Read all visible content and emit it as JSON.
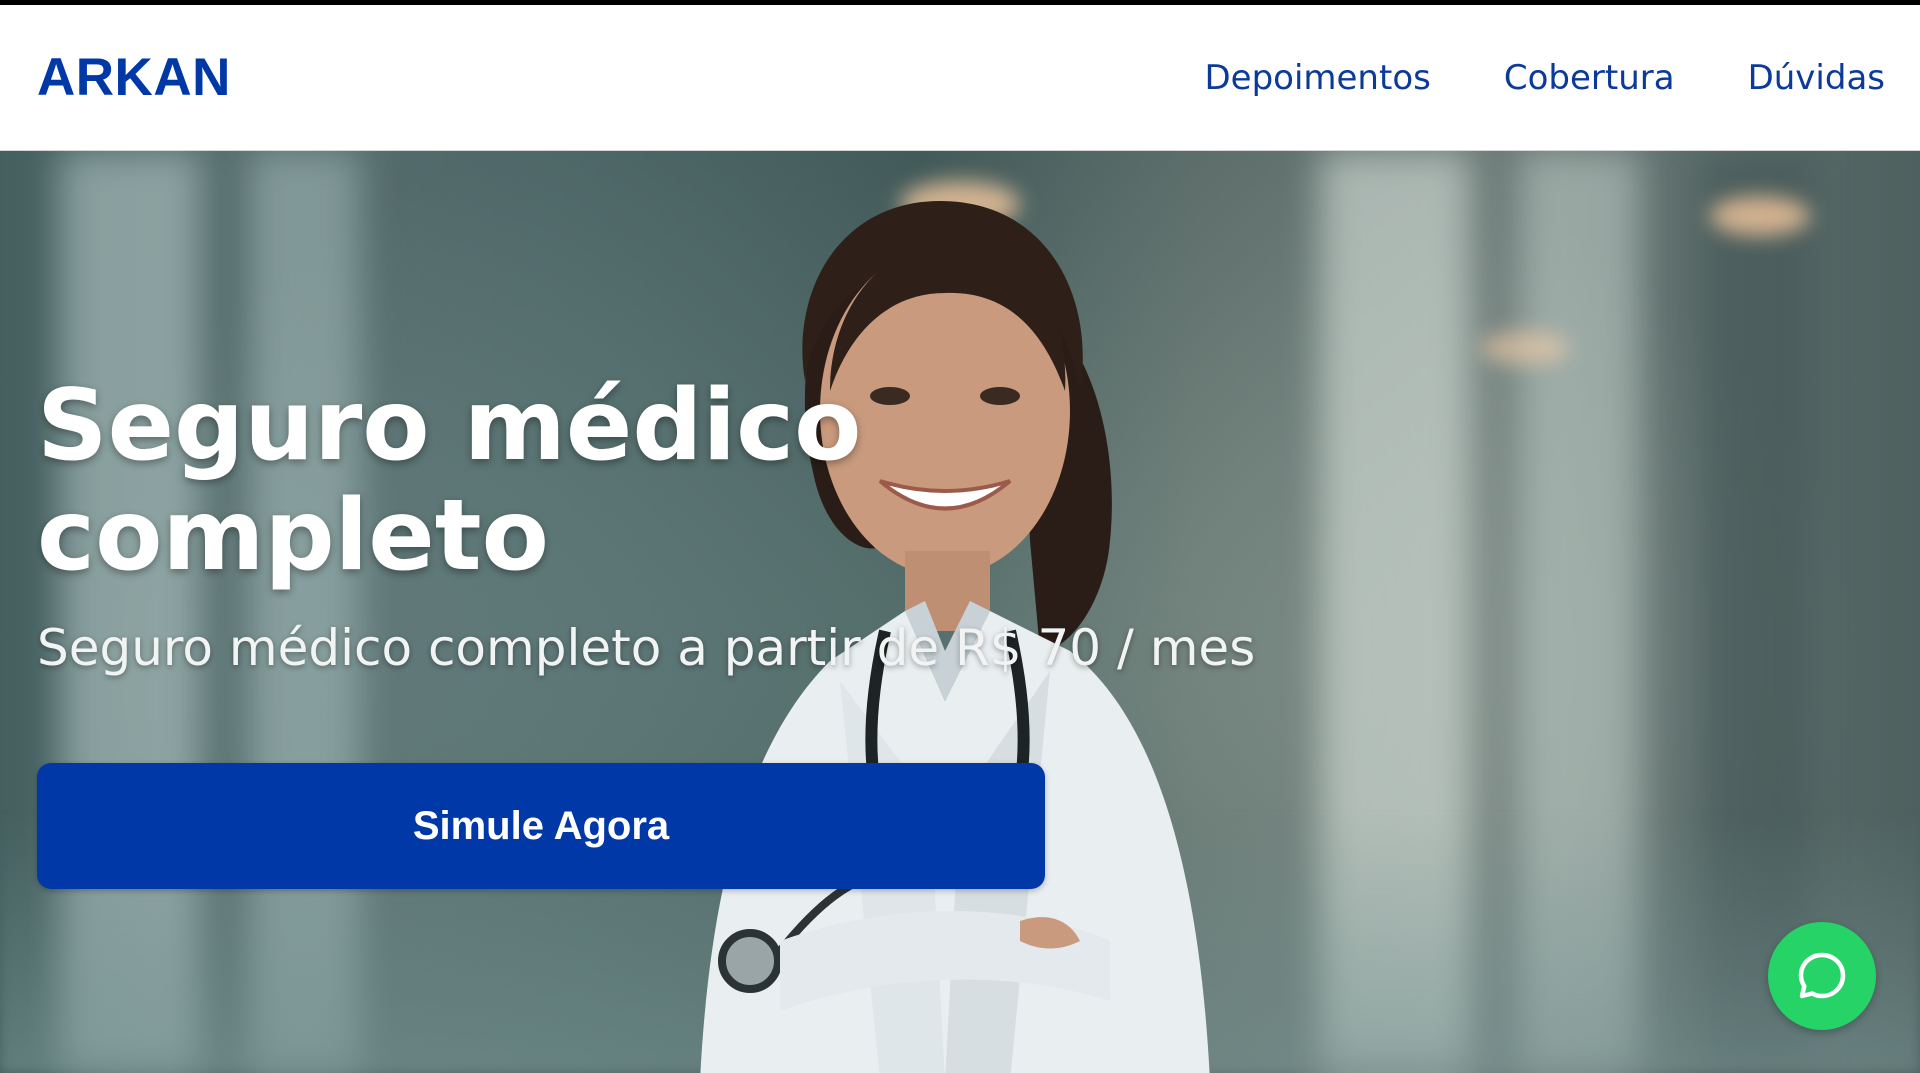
{
  "header": {
    "logo": "ARKAN",
    "nav": [
      {
        "label": "Depoimentos"
      },
      {
        "label": "Cobertura"
      },
      {
        "label": "Dúvidas"
      }
    ]
  },
  "hero": {
    "title_line1": "Seguro médico",
    "title_line2": "completo",
    "subtitle": "Seguro médico completo a partir de R$ 70 / mes",
    "cta_label": "Simule Agora",
    "background_image": "smiling-doctor-photo"
  },
  "floating": {
    "whatsapp_icon": "whatsapp-chat-icon"
  },
  "colors": {
    "brand": "#0038a8",
    "nav_text": "#0b3a9a",
    "whatsapp": "#25d366"
  }
}
